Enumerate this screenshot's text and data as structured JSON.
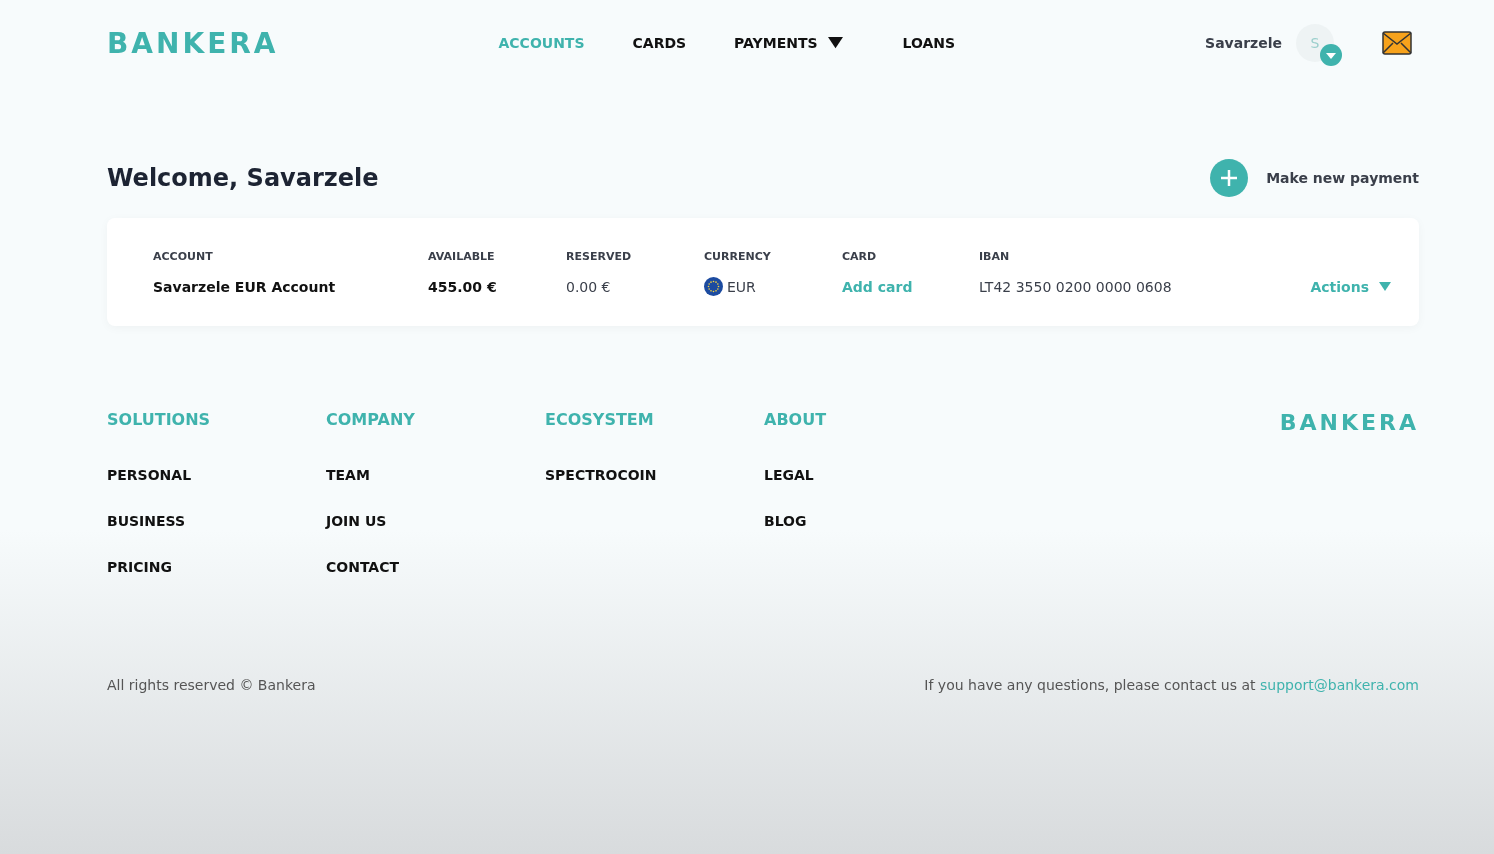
{
  "header": {
    "logo": "BANKERA",
    "nav": [
      {
        "label": "ACCOUNTS",
        "selected": true,
        "has_menu": false
      },
      {
        "label": "CARDS",
        "selected": false,
        "has_menu": false
      },
      {
        "label": "PAYMENTS",
        "selected": false,
        "has_menu": true
      },
      {
        "label": "LOANS",
        "selected": false,
        "has_menu": false
      }
    ],
    "user": {
      "name": "Savarzele",
      "initial": "S"
    }
  },
  "welcome": {
    "title": "Welcome, Savarzele",
    "action": "Make new payment"
  },
  "accounts_table": {
    "columns": [
      "ACCOUNT",
      "AVAILABLE",
      "RESERVED",
      "CURRENCY",
      "CARD",
      "IBAN"
    ],
    "rows": [
      {
        "account": "Savarzele EUR Account",
        "available": "455.00 €",
        "reserved": "0.00 €",
        "currency": "EUR",
        "card": "Add card",
        "iban": "LT42 3550 0200 0000 0608",
        "actions": "Actions"
      }
    ]
  },
  "footer": {
    "columns": [
      {
        "heading": "SOLUTIONS",
        "links": [
          "PERSONAL",
          "BUSINESS",
          "PRICING"
        ]
      },
      {
        "heading": "COMPANY",
        "links": [
          "TEAM",
          "JOIN US",
          "CONTACT"
        ]
      },
      {
        "heading": "ECOSYSTEM",
        "links": [
          "SPECTROCOIN"
        ]
      },
      {
        "heading": "ABOUT",
        "links": [
          "LEGAL",
          "BLOG"
        ]
      }
    ],
    "logo": "BANKERA",
    "copyright": "All rights reserved © Bankera",
    "contact_text": "If you have any questions, please contact us at",
    "contact_email": "support@bankera.com"
  }
}
